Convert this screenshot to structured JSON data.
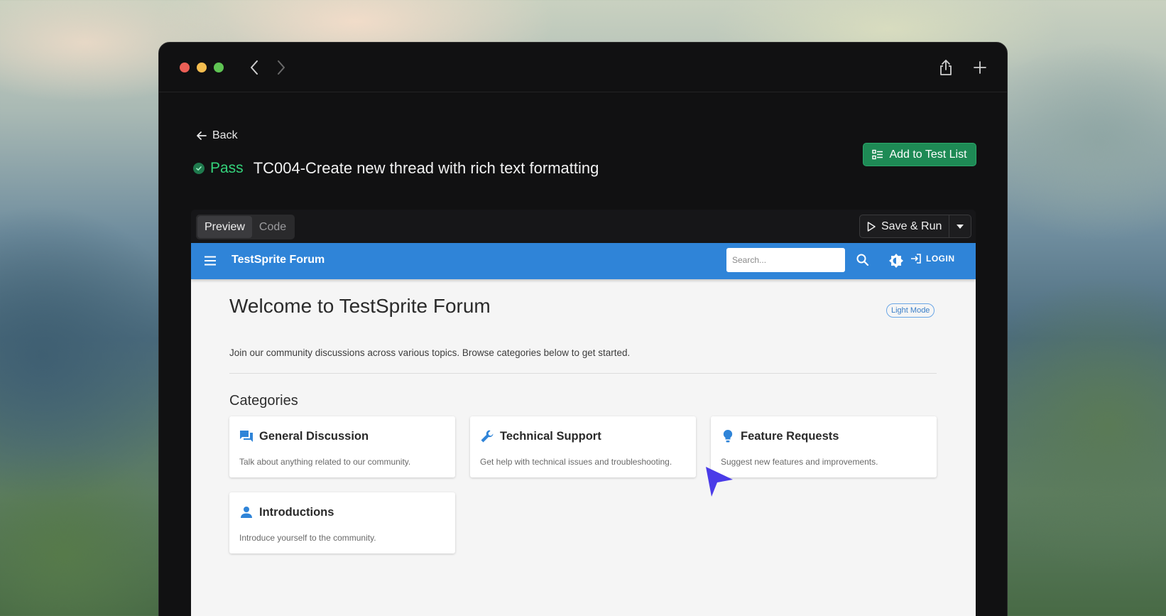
{
  "browser": {
    "back_icon": "chevron-left-icon",
    "forward_icon": "chevron-right-icon",
    "share_icon": "share-icon",
    "new_tab_icon": "plus-icon"
  },
  "header": {
    "back_label": "Back",
    "status": "Pass",
    "status_color": "#34d27b",
    "title": "TC004-Create new thread with rich text formatting",
    "add_button_label": "Add to Test List",
    "add_button_color": "#1e8a55"
  },
  "toolbar": {
    "tabs": [
      {
        "label": "Preview",
        "active": true
      },
      {
        "label": "Code",
        "active": false
      }
    ],
    "save_run_label": "Save & Run"
  },
  "app": {
    "accent": "#2f84d8",
    "title": "TestSprite Forum",
    "search_placeholder": "Search...",
    "login_label": "LOGIN",
    "welcome": "Welcome to TestSprite Forum",
    "mode_chip": "Light Mode",
    "intro": "Join our community discussions across various topics. Browse categories below to get started.",
    "categories_heading": "Categories",
    "categories": [
      {
        "icon": "forum-icon",
        "title": "General Discussion",
        "desc": "Talk about anything related to our community."
      },
      {
        "icon": "wrench-icon",
        "title": "Technical Support",
        "desc": "Get help with technical issues and troubleshooting."
      },
      {
        "icon": "lightbulb-icon",
        "title": "Feature Requests",
        "desc": "Suggest new features and improvements."
      },
      {
        "icon": "person-icon",
        "title": "Introductions",
        "desc": "Introduce yourself to the community."
      }
    ]
  }
}
